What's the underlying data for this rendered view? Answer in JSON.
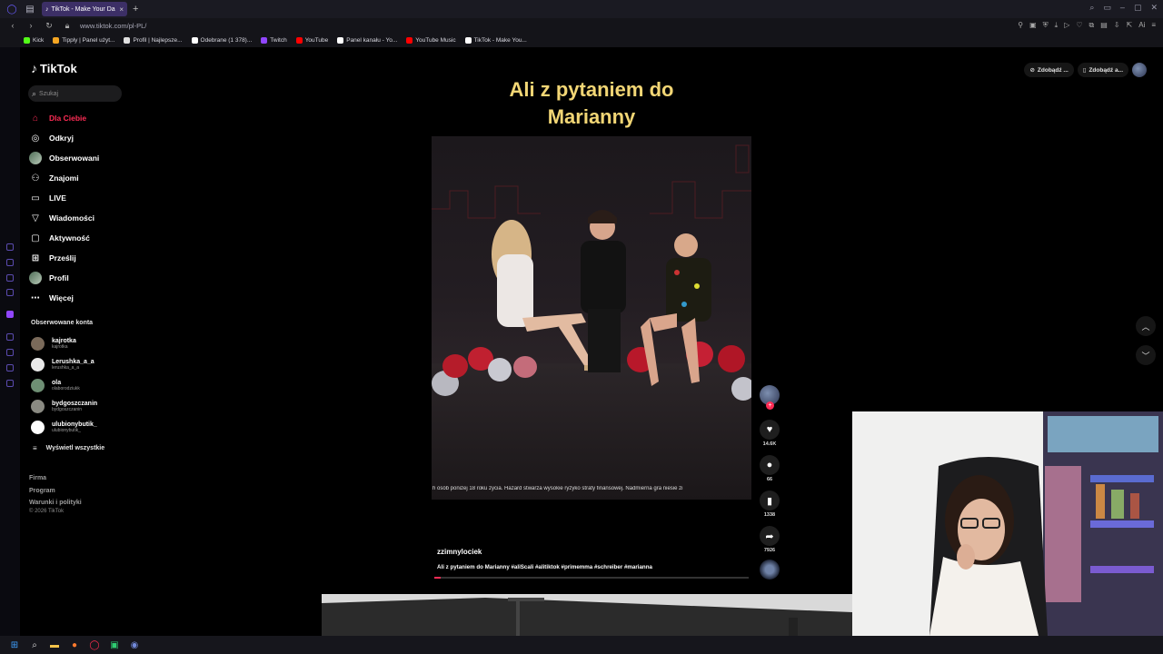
{
  "browser": {
    "tab_title": "TikTok - Make Your Da",
    "url": "www.tiktok.com/pl-PL/",
    "bookmarks": [
      {
        "label": "Kick",
        "color": "#53fc18"
      },
      {
        "label": "Tipply | Panel użyt...",
        "color": "#f5a623"
      },
      {
        "label": "Profil | Najlepsze...",
        "color": "#e0e0e0"
      },
      {
        "label": "Odebrane (1 378)...",
        "color": "#ffffff"
      },
      {
        "label": "Twitch",
        "color": "#9146ff"
      },
      {
        "label": "YouTube",
        "color": "#ff0000"
      },
      {
        "label": "Panel kanału - Yo...",
        "color": "#ffffff"
      },
      {
        "label": "YouTube Music",
        "color": "#ff0000"
      },
      {
        "label": "TikTok - Make You...",
        "color": "#ffffff"
      }
    ]
  },
  "tiktok": {
    "brand": "TikTok",
    "search_placeholder": "Szukaj",
    "nav": [
      {
        "label": "Dla Ciebie",
        "icon": "home-icon",
        "glyph": "⌂",
        "active": true
      },
      {
        "label": "Odkryj",
        "icon": "compass-icon",
        "glyph": "◎"
      },
      {
        "label": "Obserwowani",
        "icon": "avatar-icon",
        "glyph": ""
      },
      {
        "label": "Znajomi",
        "icon": "friends-icon",
        "glyph": "⚇"
      },
      {
        "label": "LIVE",
        "icon": "live-icon",
        "glyph": "▭"
      },
      {
        "label": "Wiadomości",
        "icon": "messages-icon",
        "glyph": "▽"
      },
      {
        "label": "Aktywność",
        "icon": "activity-icon",
        "glyph": "▢"
      },
      {
        "label": "Prześlij",
        "icon": "upload-icon",
        "glyph": "⊞"
      },
      {
        "label": "Profil",
        "icon": "profile-icon",
        "glyph": ""
      },
      {
        "label": "Więcej",
        "icon": "more-icon",
        "glyph": "⋯"
      }
    ],
    "followed_title": "Obserwowane konta",
    "accounts": [
      {
        "name": "kajrotka",
        "handle": "kajrotka",
        "color": "#7a6a5a"
      },
      {
        "name": "Lerushka_a_a",
        "handle": "lerushka_a_a",
        "color": "#e9e9e9"
      },
      {
        "name": "ola",
        "handle": "olaborodziukk",
        "color": "#6e8f74"
      },
      {
        "name": "bydgoszczanin",
        "handle": "bydgoszczanin",
        "color": "#8a8a82"
      },
      {
        "name": "ulubionybutik_",
        "handle": "ulubionybutik_",
        "color": "#ffffff"
      }
    ],
    "see_all": "Wyświetl wszystkie",
    "footer": [
      "Firma",
      "Program",
      "Warunki i polityki"
    ],
    "copyright": "© 2026 TikTok",
    "top_buttons": [
      "Zdobądź ...",
      "Zdobądź a..."
    ]
  },
  "video": {
    "title_line1": "Ali z pytaniem do",
    "title_line2": "Marianny",
    "caption_strip": "h osób poniżej 18 roku życia. Hazard stwarza wysokie ryzyko straty finansowej. Nadmierna gra niesie zi",
    "author": "zzimnylociek",
    "description": "Ali z pytaniem do Marianny #aliScali #alitiktok #primemma #schreiber #marianna",
    "likes": "14.6K",
    "comments": "66",
    "saves": "1338",
    "shares": "7926",
    "progress": 0.02,
    "title_color": "#f2d675"
  }
}
